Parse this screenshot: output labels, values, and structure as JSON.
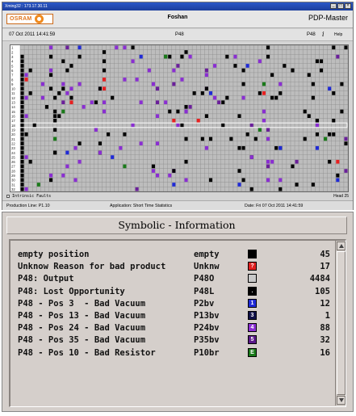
{
  "window1": {
    "title": "Xming32 : 173.17.30.11",
    "brand_logo_text": "OSRAM",
    "location": "Foshan",
    "app_name": "PDP-Master",
    "datetime": "07 Oct 2011 14:41:59",
    "machine": "P48",
    "machine_right": "P48",
    "info_icon": "i",
    "help_label": "Help",
    "footer_label": "Intrinsic Faults",
    "footer_count_label": "Head",
    "footer_count_value": "25",
    "status": {
      "production_line": "Production Line:  P1.10",
      "application": "Application:  Short Time Statistics",
      "date": "Date:  Fri 07 Oct 2011 14:41:59"
    },
    "grid": {
      "columns": 80,
      "rows": 32,
      "row_labels": [
        "1",
        "2",
        "3",
        "4",
        "5",
        "6",
        "7",
        "8",
        "9",
        "10",
        "11",
        "12",
        "13",
        "14",
        "15",
        "16",
        "17",
        "18",
        "19",
        "20",
        "21",
        "22",
        "23",
        "24",
        "25",
        "26",
        "27",
        "28",
        "29",
        "30",
        "31",
        "32"
      ],
      "cell_colors": {
        "empty": "#bdbdbd",
        "unknown": "#e82020",
        "output": "#bdbdbd",
        "lost_opportunity": "#000000",
        "pos3": "#1f2ad6",
        "pos13": "#231a6e",
        "pos24": "#8a2ed2",
        "pos35": "#6a1f9a",
        "pos10": "#1a7a1a"
      }
    }
  },
  "window2": {
    "title": "Symbolic - Information",
    "rows": [
      {
        "desc": "empty position",
        "code": "empty",
        "swatch_color": "#000000",
        "glyph": "",
        "count": "45"
      },
      {
        "desc": "Unknow Reason for bad product",
        "code": "Unknw",
        "swatch_color": "#e02020",
        "glyph": "?",
        "count": "17"
      },
      {
        "desc": "P48: Output",
        "code": "P48O",
        "swatch_color": "#c8c8c8",
        "glyph": "",
        "count": "4484"
      },
      {
        "desc": "P48: Lost Opportunity",
        "code": "P48L",
        "swatch_color": "#000000",
        "glyph": ".",
        "count": "105"
      },
      {
        "desc": "P48 - Pos 3  - Bad Vacuum",
        "code": "P2bv",
        "swatch_color": "#1f2ad6",
        "glyph": "1",
        "count": "12"
      },
      {
        "desc": "P48 - Pos 13 - Bad Vacuum",
        "code": "P13bv",
        "swatch_color": "#101048",
        "glyph": "3",
        "count": "1"
      },
      {
        "desc": "P48 - Pos 24 - Bad Vacuum",
        "code": "P24bv",
        "swatch_color": "#8a2ed2",
        "glyph": "4",
        "count": "88"
      },
      {
        "desc": "P48 - Pos 35 - Bad Vacuum",
        "code": "P35bv",
        "swatch_color": "#5a1a8a",
        "glyph": "5",
        "count": "32"
      },
      {
        "desc": "P48 - Pos 10 - Bad Resistor",
        "code": "P10br",
        "swatch_color": "#1a7a1a",
        "glyph": "E",
        "count": "16"
      }
    ]
  }
}
